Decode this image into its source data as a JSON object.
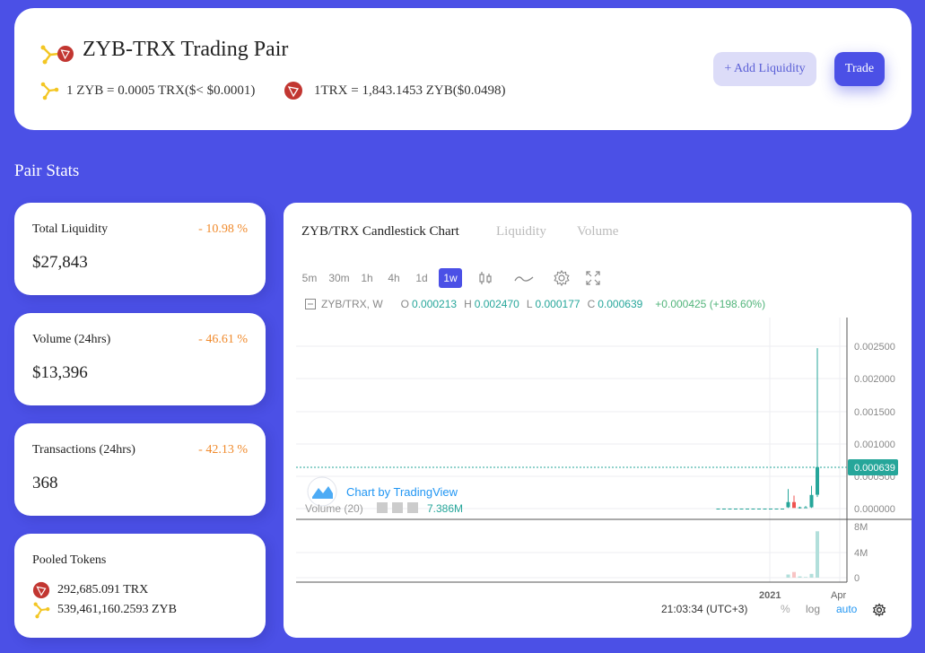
{
  "header": {
    "title": "ZYB-TRX Trading Pair",
    "rate_zyb": "1 ZYB = 0.0005 TRX($< $0.0001)",
    "rate_trx": "1TRX = 1,843.1453 ZYB($0.0498)",
    "add_liquidity_label": "+ Add Liquidity",
    "trade_label": "Trade"
  },
  "section_title": "Pair Stats",
  "stats": [
    {
      "label": "Total Liquidity",
      "change": "- 10.98 %",
      "value": "$27,843"
    },
    {
      "label": "Volume (24hrs)",
      "change": "- 46.61 %",
      "value": "$13,396"
    },
    {
      "label": "Transactions (24hrs)",
      "change": "- 42.13 %",
      "value": "368"
    }
  ],
  "pooled": {
    "label": "Pooled Tokens",
    "trx": "292,685.091 TRX",
    "zyb": "539,461,160.2593 ZYB"
  },
  "chart": {
    "tabs": [
      "ZYB/TRX Candlestick Chart",
      "Liquidity",
      "Volume"
    ],
    "timeframes": [
      "5m",
      "30m",
      "1h",
      "4h",
      "1d",
      "1w"
    ],
    "active_timeframe": "1w",
    "legend": {
      "symbol": "ZYB/TRX, W",
      "o_label": "O",
      "o": "0.000213",
      "h_label": "H",
      "h": "0.002470",
      "l_label": "L",
      "l": "0.000177",
      "c_label": "C",
      "c": "0.000639",
      "change": "+0.000425 (+198.60%)"
    },
    "watermark": "Chart by TradingView",
    "volume_label": "Volume (20)",
    "volume_value": "7.386M",
    "price_ticks": [
      "0.002500",
      "0.002000",
      "0.001500",
      "0.001000",
      "0.000500",
      "0.000000"
    ],
    "last_price": "0.000639",
    "volume_ticks": [
      "8M",
      "4M",
      "0"
    ],
    "time_labels": [
      "2021",
      "Apr"
    ],
    "clock": "21:03:34 (UTC+3)",
    "percent_label": "%",
    "log_label": "log",
    "auto_label": "auto",
    "colors": {
      "up": "#26a69a",
      "down": "#ef5350",
      "accent": "#4b50e6",
      "change": "#f08a2c"
    }
  },
  "chart_data": {
    "type": "candlestick",
    "title": "ZYB/TRX Candlestick Chart",
    "interval": "1w",
    "ylim": [
      0,
      0.0027
    ],
    "last": 0.000639,
    "candles": [
      {
        "o": 0.0,
        "h": 0.0,
        "l": 0.0,
        "c": 0.0
      },
      {
        "o": 0.0,
        "h": 0.0,
        "l": 0.0,
        "c": 0.0
      },
      {
        "o": 0.0,
        "h": 0.0,
        "l": 0.0,
        "c": 0.0
      },
      {
        "o": 0.0,
        "h": 0.0,
        "l": 0.0,
        "c": 0.0
      },
      {
        "o": 0.0,
        "h": 0.0,
        "l": 0.0,
        "c": 0.0
      },
      {
        "o": 0.0,
        "h": 0.0,
        "l": 0.0,
        "c": 0.0
      },
      {
        "o": 0.0,
        "h": 0.0,
        "l": 0.0,
        "c": 0.0
      },
      {
        "o": 0.0,
        "h": 0.0,
        "l": 0.0,
        "c": 0.0
      },
      {
        "o": 0.0,
        "h": 0.0,
        "l": 0.0,
        "c": 0.0
      },
      {
        "o": 0.0,
        "h": 0.0,
        "l": 0.0,
        "c": 0.0
      },
      {
        "o": 0.0,
        "h": 0.0,
        "l": 0.0,
        "c": 0.0
      },
      {
        "o": 0.0,
        "h": 0.0,
        "l": 0.0,
        "c": 0.0
      },
      {
        "o": 2e-05,
        "h": 0.0003,
        "l": 1e-05,
        "c": 0.0001
      },
      {
        "o": 0.0001,
        "h": 0.0002,
        "l": 2e-05,
        "c": 1e-05
      },
      {
        "o": 1e-05,
        "h": 3e-05,
        "l": 0.0,
        "c": 2e-05
      },
      {
        "o": 2e-05,
        "h": 4e-05,
        "l": 1e-05,
        "c": 2e-05
      },
      {
        "o": 2e-05,
        "h": 0.00035,
        "l": 1e-05,
        "c": 0.00021
      },
      {
        "o": 0.000213,
        "h": 0.00247,
        "l": 0.000177,
        "c": 0.000639
      }
    ],
    "volumes": [
      0,
      0,
      0,
      0,
      0,
      0,
      0,
      0,
      0,
      0,
      0,
      0,
      0.5,
      0.9,
      0.2,
      0.1,
      0.6,
      7.386
    ],
    "volume_ylim": [
      0,
      10
    ]
  }
}
